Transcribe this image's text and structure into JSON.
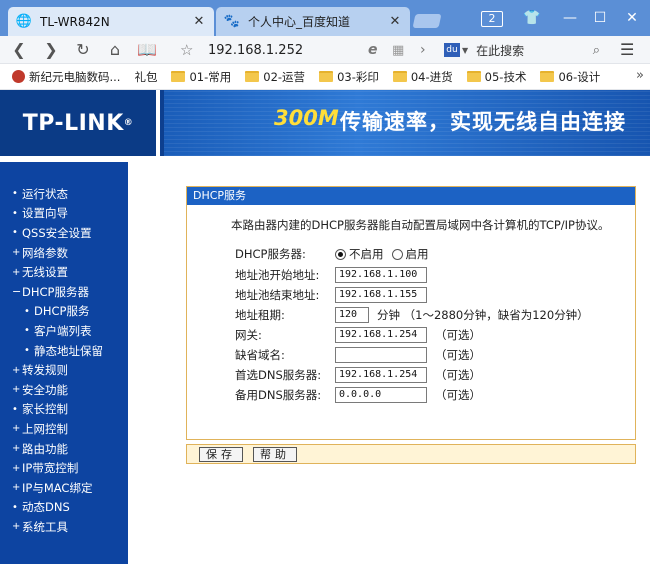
{
  "browser": {
    "tabs": [
      {
        "title": "TL-WR842N",
        "icon": "globe-icon",
        "active": true
      },
      {
        "title": "个人中心_百度知道",
        "icon": "baidu-paw-icon",
        "active": false
      }
    ],
    "tab_count": "2",
    "address": "192.168.1.252",
    "search_placeholder": "在此搜索"
  },
  "bookmarks": [
    {
      "label": "新纪元电脑数码...",
      "type": "site"
    },
    {
      "label": "礼包",
      "type": "text"
    },
    {
      "label": "01-常用",
      "type": "folder"
    },
    {
      "label": "02-运营",
      "type": "folder"
    },
    {
      "label": "03-彩印",
      "type": "folder"
    },
    {
      "label": "04-进货",
      "type": "folder"
    },
    {
      "label": "05-技术",
      "type": "folder"
    },
    {
      "label": "06-设计",
      "type": "folder"
    }
  ],
  "router": {
    "logo": "TP-LINK",
    "logo_mark": "®",
    "slogan_speed": "300M",
    "slogan": "传输速率，实现无线自由连接"
  },
  "sidebar": [
    {
      "label": "运行状态",
      "level": 1,
      "marker": "•"
    },
    {
      "label": "设置向导",
      "level": 1,
      "marker": "•"
    },
    {
      "label": "QSS安全设置",
      "level": 1,
      "marker": "•"
    },
    {
      "label": "网络参数",
      "level": 1,
      "marker": "+"
    },
    {
      "label": "无线设置",
      "level": 1,
      "marker": "+"
    },
    {
      "label": "DHCP服务器",
      "level": 1,
      "marker": "−"
    },
    {
      "label": "DHCP服务",
      "level": 2,
      "marker": "•"
    },
    {
      "label": "客户端列表",
      "level": 2,
      "marker": "•"
    },
    {
      "label": "静态地址保留",
      "level": 2,
      "marker": "•"
    },
    {
      "label": "转发规则",
      "level": 1,
      "marker": "+"
    },
    {
      "label": "安全功能",
      "level": 1,
      "marker": "+"
    },
    {
      "label": "家长控制",
      "level": 1,
      "marker": "•"
    },
    {
      "label": "上网控制",
      "level": 1,
      "marker": "+"
    },
    {
      "label": "路由功能",
      "level": 1,
      "marker": "+"
    },
    {
      "label": "IP带宽控制",
      "level": 1,
      "marker": "+"
    },
    {
      "label": "IP与MAC绑定",
      "level": 1,
      "marker": "+"
    },
    {
      "label": "动态DNS",
      "level": 1,
      "marker": "•"
    },
    {
      "label": "系统工具",
      "level": 1,
      "marker": "+"
    }
  ],
  "panel": {
    "title": "DHCP服务",
    "intro": "本路由器内建的DHCP服务器能自动配置局域网中各计算机的TCP/IP协议。",
    "dhcp_label": "DHCP服务器:",
    "radio_off": "不启用",
    "radio_on": "启用",
    "radio_selected": "off",
    "fields": [
      {
        "label": "地址池开始地址:",
        "value": "192.168.1.100",
        "note": ""
      },
      {
        "label": "地址池结束地址:",
        "value": "192.168.1.155",
        "note": ""
      },
      {
        "label": "地址租期:",
        "value": "120",
        "note": "分钟 （1～2880分钟，缺省为120分钟）"
      },
      {
        "label": "网关:",
        "value": "192.168.1.254",
        "note": "（可选）"
      },
      {
        "label": "缺省域名:",
        "value": "",
        "note": "（可选）"
      },
      {
        "label": "首选DNS服务器:",
        "value": "192.168.1.254",
        "note": "（可选）"
      },
      {
        "label": "备用DNS服务器:",
        "value": "0.0.0.0",
        "note": "（可选）"
      }
    ],
    "save_label": "保存",
    "help_label": "帮助"
  },
  "colors": {
    "tabstrip": "#5b8fd6",
    "sidebar": "#0d44a1",
    "panel_title": "#1c62c4",
    "panel_border": "#e0b35a",
    "slogan_accent": "#ffde3a"
  }
}
